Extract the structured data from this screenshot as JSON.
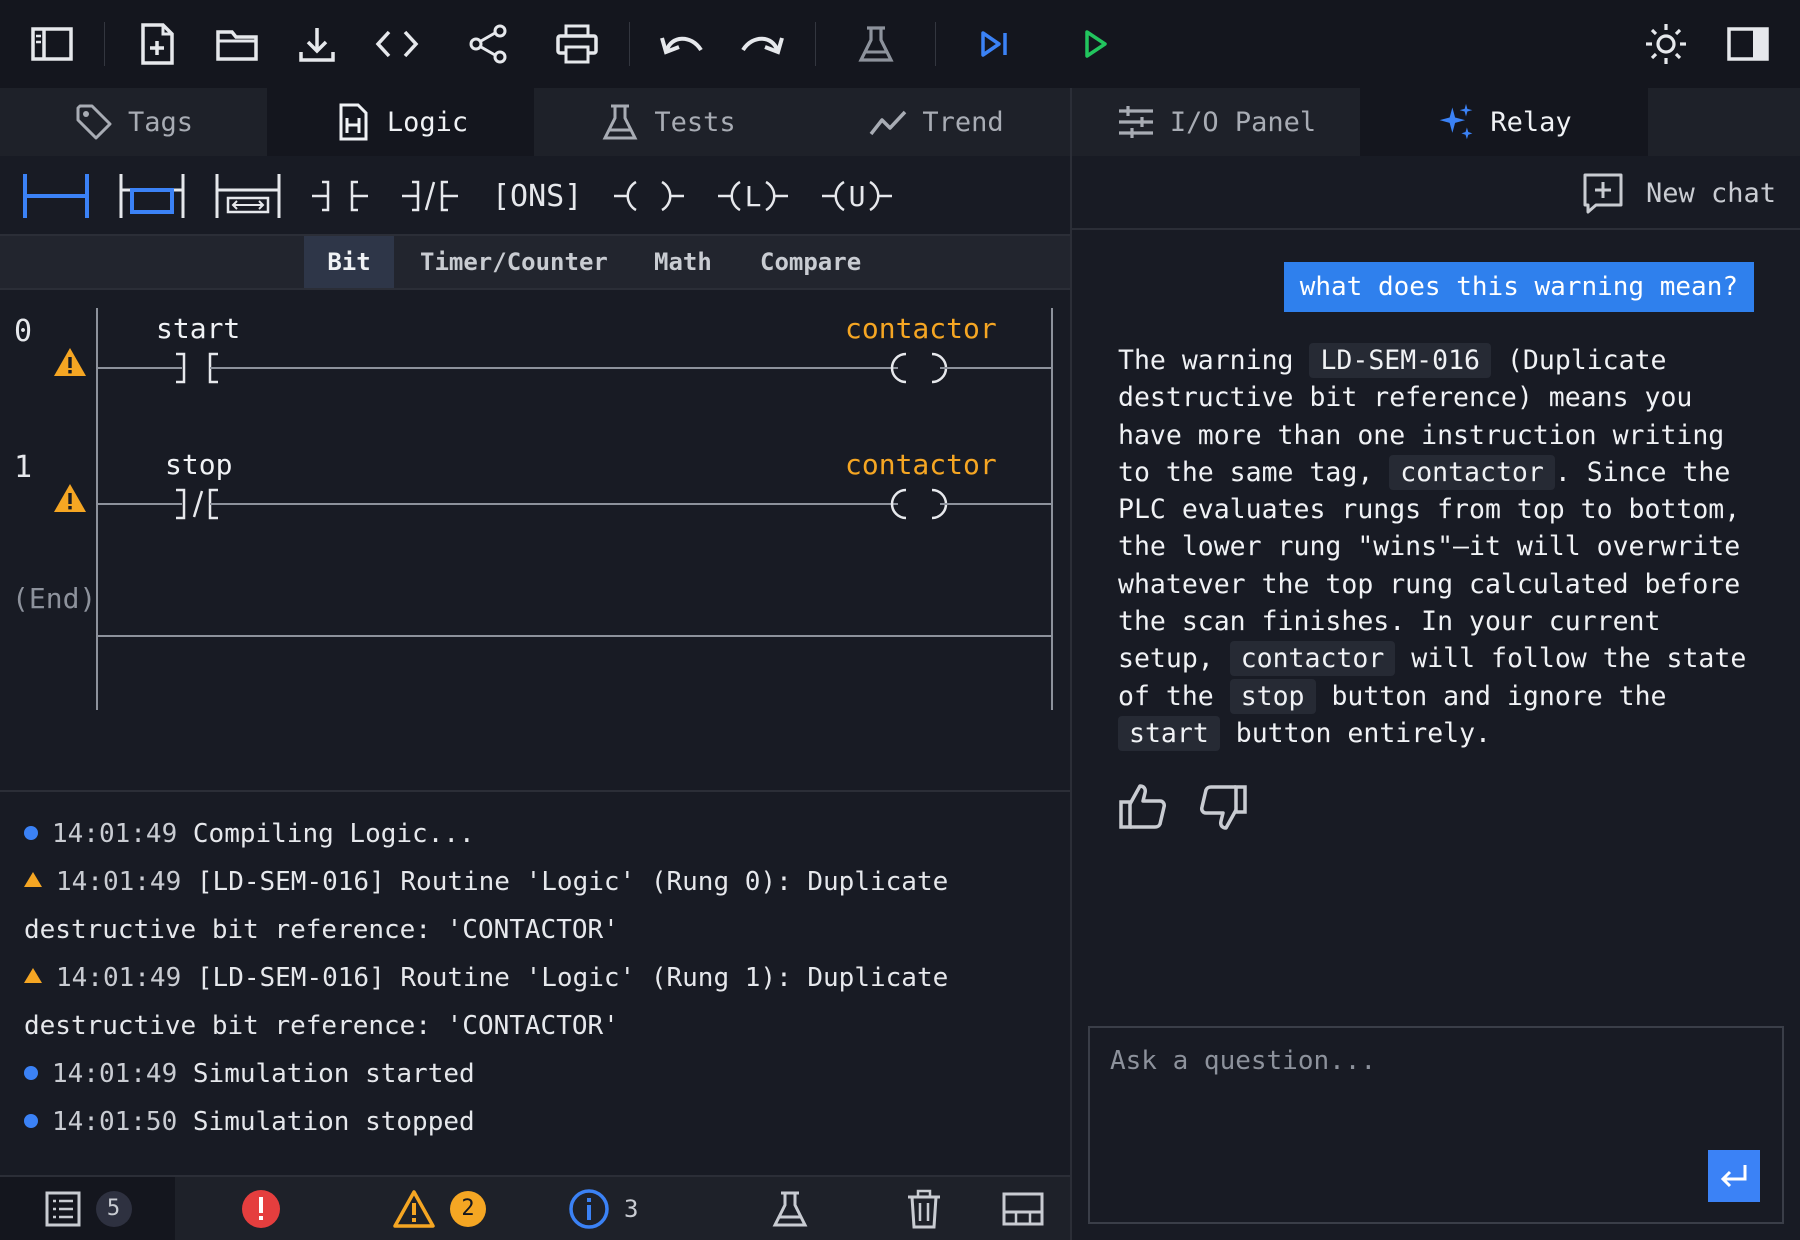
{
  "toolbar": {
    "buttons": [
      "toggle-sidebar",
      "new-file",
      "open-folder",
      "download",
      "code",
      "share",
      "print",
      "undo",
      "redo",
      "test-flask",
      "step",
      "run",
      "theme",
      "toggle-right-panel"
    ],
    "colors": {
      "step": "#3b82f6",
      "run": "#22c55e"
    }
  },
  "left_tabs": [
    {
      "label": "Tags",
      "icon": "tag-icon",
      "active": false
    },
    {
      "label": "Logic",
      "icon": "document-icon",
      "active": true
    },
    {
      "label": "Tests",
      "icon": "flask-icon",
      "active": false
    },
    {
      "label": "Trend",
      "icon": "trend-icon",
      "active": false
    }
  ],
  "right_tabs": [
    {
      "label": "I/O Panel",
      "icon": "sliders-icon",
      "active": false
    },
    {
      "label": "Relay",
      "icon": "sparkle-icon",
      "active": true
    }
  ],
  "instructions": {
    "ons": "[ONS]",
    "latch": "L",
    "unlatch": "U"
  },
  "categories": [
    {
      "label": "Bit",
      "active": true
    },
    {
      "label": "Timer/Counter",
      "active": false
    },
    {
      "label": "Math",
      "active": false
    },
    {
      "label": "Compare",
      "active": false
    }
  ],
  "rungs": [
    {
      "number": "0",
      "input_tag": "start",
      "input_type": "XIC",
      "output_tag": "contactor",
      "warning": true
    },
    {
      "number": "1",
      "input_tag": "stop",
      "input_type": "XIO",
      "output_tag": "contactor",
      "warning": true
    }
  ],
  "end_label": "(End)",
  "console": {
    "lines": [
      {
        "level": "info",
        "time": "14:01:49",
        "text": "Compiling Logic..."
      },
      {
        "level": "warn",
        "time": "14:01:49",
        "text": "[LD-SEM-016] Routine 'Logic' (Rung 0): Duplicate destructive bit reference: 'CONTACTOR'"
      },
      {
        "level": "warn",
        "time": "14:01:49",
        "text": "[LD-SEM-016] Routine 'Logic' (Rung 1): Duplicate destructive bit reference: 'CONTACTOR'"
      },
      {
        "level": "info",
        "time": "14:01:49",
        "text": "Simulation started"
      },
      {
        "level": "info",
        "time": "14:01:50",
        "text": "Simulation stopped"
      }
    ]
  },
  "status": {
    "all_count": "5",
    "warn_count": "2",
    "info_count": "3",
    "error_color": "#e53e3e",
    "warn_color": "#f5a623",
    "info_color": "#3b82f6"
  },
  "chat": {
    "new_chat_label": "New chat",
    "user_message": "what does this warning mean?",
    "ai_message": {
      "p1": "The warning ",
      "code1": "LD-SEM-016",
      "p2": " (Duplicate destructive bit reference) means you have more than one instruction writing to the same tag, ",
      "code2": "contactor",
      "p3": ". Since the PLC evaluates rungs from top to bottom, the lower rung \"wins\"—it will overwrite whatever the top rung calculated before the scan finishes. In your current setup, ",
      "code3": "contactor",
      "p4": " will follow the state of the ",
      "code4": "stop",
      "p5": " button and ignore the ",
      "code5": "start",
      "p6": " button entirely."
    },
    "input_placeholder": "Ask a question..."
  }
}
